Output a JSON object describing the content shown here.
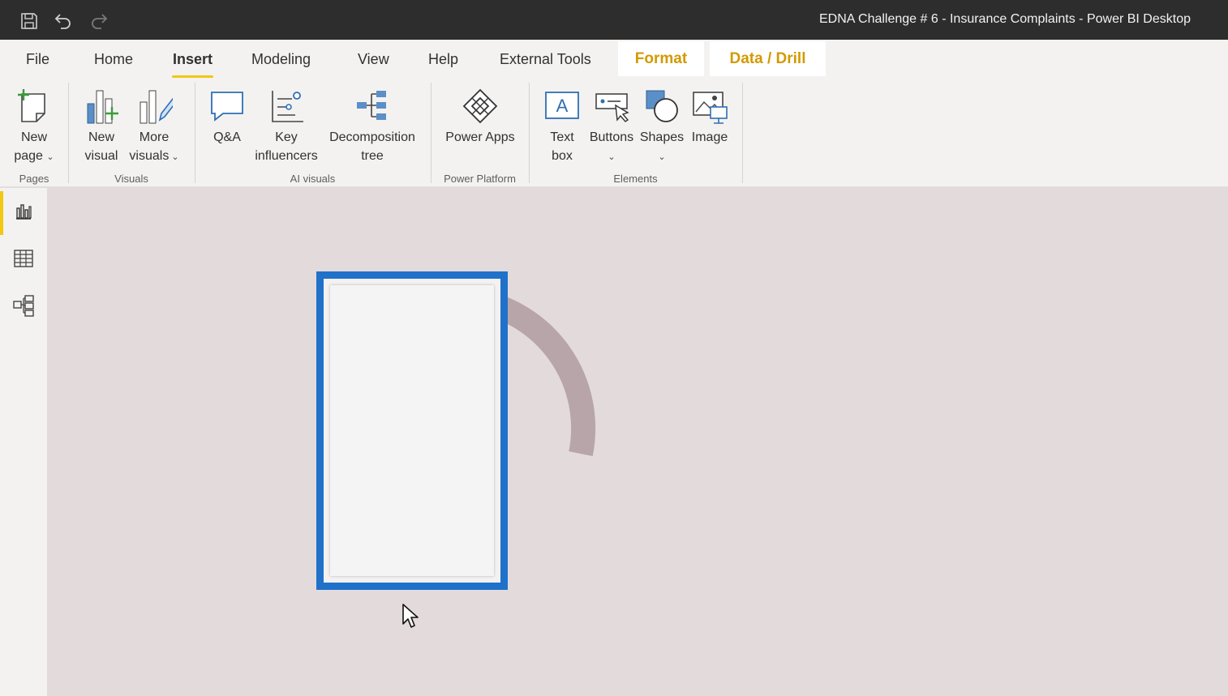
{
  "window": {
    "title": "EDNA Challenge # 6 - Insurance Complaints - Power BI Desktop",
    "quick_access": [
      "save-icon",
      "undo-icon",
      "redo-icon"
    ]
  },
  "tabs": {
    "file": "File",
    "home": "Home",
    "insert": "Insert",
    "modeling": "Modeling",
    "view": "View",
    "help": "Help",
    "external_tools": "External Tools",
    "format": "Format",
    "data_drill": "Data / Drill",
    "active": "Insert",
    "active_color": "#f2c811",
    "contextual_color": "#d29a00"
  },
  "ribbon": {
    "pages": {
      "label": "Pages",
      "new_page": {
        "line1": "New",
        "line2": "page",
        "icon": "new-page-icon"
      }
    },
    "visuals": {
      "label": "Visuals",
      "new_visual": {
        "line1": "New",
        "line2": "visual",
        "icon": "new-visual-icon"
      },
      "more_visuals": {
        "line1": "More",
        "line2": "visuals",
        "icon": "more-visuals-icon"
      }
    },
    "ai_visuals": {
      "label": "AI visuals",
      "qa": {
        "line1": "Q&A",
        "icon": "qa-icon"
      },
      "key_influencers": {
        "line1": "Key",
        "line2": "influencers",
        "icon": "key-influencers-icon"
      },
      "decomposition_tree": {
        "line1": "Decomposition",
        "line2": "tree",
        "icon": "decomposition-tree-icon"
      }
    },
    "power_platform": {
      "label": "Power Platform",
      "power_apps": {
        "line1": "Power Apps",
        "icon": "power-apps-icon"
      }
    },
    "elements": {
      "label": "Elements",
      "text_box": {
        "line1": "Text",
        "line2": "box",
        "icon": "text-box-icon"
      },
      "buttons": {
        "line1": "Buttons",
        "icon": "buttons-icon"
      },
      "shapes": {
        "line1": "Shapes",
        "icon": "shapes-icon"
      },
      "image": {
        "line1": "Image",
        "icon": "image-icon"
      }
    }
  },
  "leftnav": {
    "items": [
      "report-view-icon",
      "data-view-icon",
      "model-view-icon"
    ],
    "active": "report-view-icon"
  },
  "canvas": {
    "background": "#e3dadc",
    "selected_visual_border": "#1f71c9",
    "loading_spinner": true
  }
}
